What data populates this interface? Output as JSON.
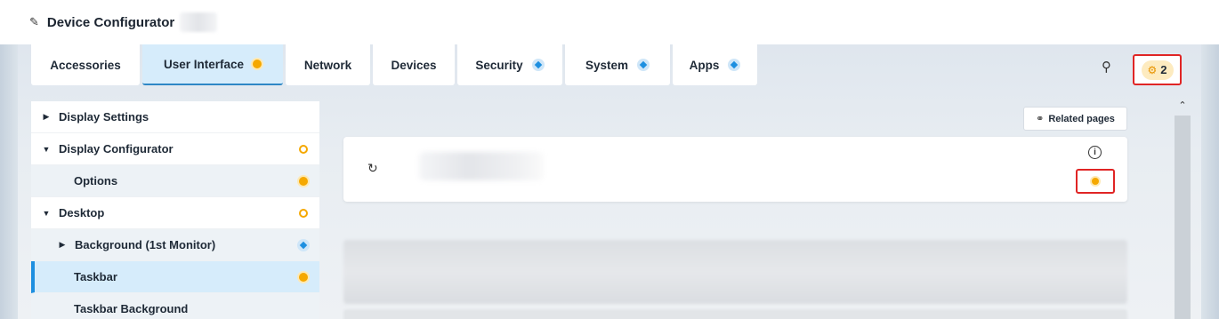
{
  "app": {
    "title": "Device Configurator"
  },
  "tabs": [
    {
      "label": "Accessories",
      "status": "none"
    },
    {
      "label": "User Interface",
      "status": "changed"
    },
    {
      "label": "Network",
      "status": "none"
    },
    {
      "label": "Devices",
      "status": "none"
    },
    {
      "label": "Security",
      "status": "info"
    },
    {
      "label": "System",
      "status": "info"
    },
    {
      "label": "Apps",
      "status": "info"
    }
  ],
  "active_tab": "User Interface",
  "notifications": {
    "count": "2"
  },
  "sidebar": {
    "items": [
      {
        "label": "Display Settings",
        "expanded": false,
        "level": 0,
        "status": "none"
      },
      {
        "label": "Display Configurator",
        "expanded": true,
        "level": 0,
        "status": "ring"
      },
      {
        "label": "Options",
        "level": 1,
        "status": "changed"
      },
      {
        "label": "Desktop",
        "expanded": true,
        "level": 0,
        "status": "ring"
      },
      {
        "label": "Background (1st Monitor)",
        "expanded": false,
        "level": 1,
        "status": "info"
      },
      {
        "label": "Taskbar",
        "level": 1,
        "status": "changed",
        "selected": true
      },
      {
        "label": "Taskbar Background",
        "level": 1,
        "status": "none"
      }
    ]
  },
  "main": {
    "related_pages_label": "Related pages",
    "info_glyph": "i"
  },
  "colors": {
    "accent_blue": "#1d8fe0",
    "changed_orange": "#f5a800",
    "highlight_red": "#e02525",
    "active_tab_bg": "#d6ecfb"
  },
  "icons": {
    "title": "pencil-icon",
    "search": "search-icon",
    "notification": "gear-badge-icon",
    "related": "link-icon",
    "refresh": "refresh-icon",
    "info": "info-icon",
    "scroll_up": "chevron-up-icon"
  }
}
